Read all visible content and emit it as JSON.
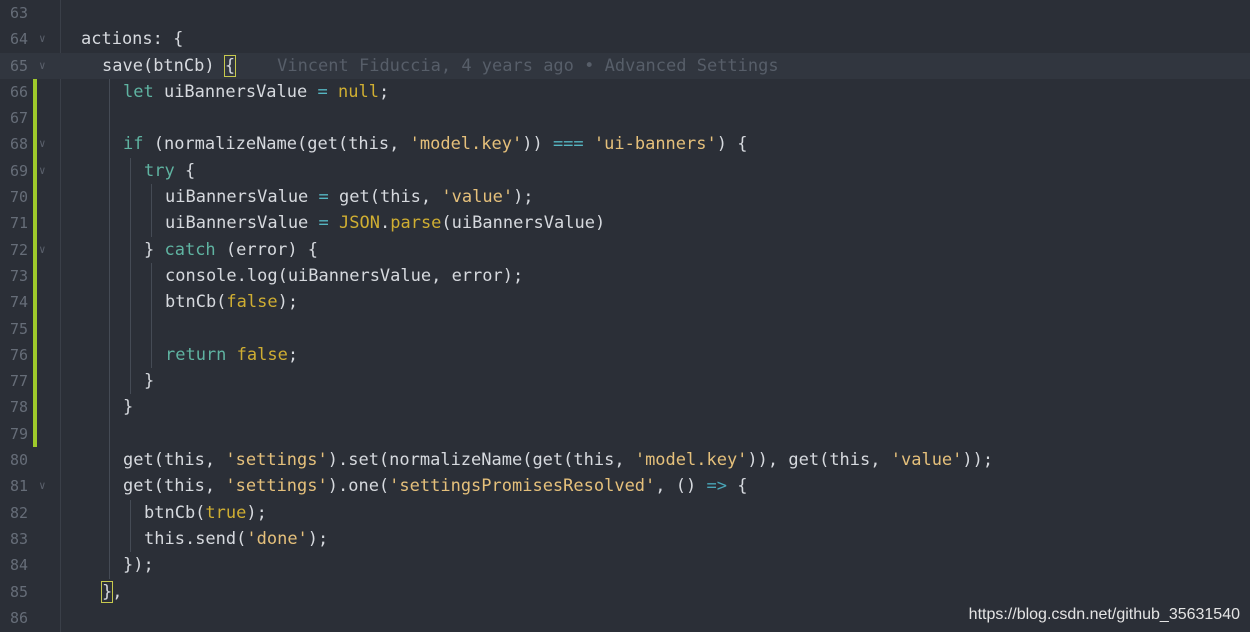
{
  "editor": {
    "colors": {
      "background": "#2b2f37",
      "current_line": "#31363f",
      "line_number": "#666d78",
      "plain": "#d6d9de",
      "keyword": "#5fb3a1",
      "string": "#e5c07b",
      "builtin": "#cfae32",
      "blame": "#575e69",
      "modified_marker": "#9fca2b",
      "operator": "#56b6c2",
      "arrow": "#49a6b8"
    },
    "blame_text": "Vincent Fiduccia, 4 years ago • Advanced Settings",
    "lines": [
      {
        "num": "63",
        "fold": false,
        "modified": false,
        "current": false,
        "indent": 0,
        "tokens": []
      },
      {
        "num": "64",
        "fold": true,
        "modified": false,
        "current": false,
        "indent": 0,
        "tokens": [
          {
            "t": "actions: {",
            "c": "plain"
          }
        ]
      },
      {
        "num": "65",
        "fold": true,
        "modified": false,
        "current": true,
        "indent": 1,
        "blame": true,
        "tokens": [
          {
            "t": "save",
            "c": "plain"
          },
          {
            "t": "(btnCb) ",
            "c": "plain"
          },
          {
            "t": "{",
            "c": "plain",
            "hl": true
          }
        ]
      },
      {
        "num": "66",
        "fold": false,
        "modified": true,
        "current": false,
        "indent": 2,
        "tokens": [
          {
            "t": "let ",
            "c": "keyword"
          },
          {
            "t": "uiBannersValue ",
            "c": "plain"
          },
          {
            "t": "=",
            "c": "operator"
          },
          {
            "t": " ",
            "c": "plain"
          },
          {
            "t": "null",
            "c": "builtin"
          },
          {
            "t": ";",
            "c": "plain"
          }
        ]
      },
      {
        "num": "67",
        "fold": false,
        "modified": true,
        "current": false,
        "indent": 2,
        "tokens": []
      },
      {
        "num": "68",
        "fold": true,
        "modified": true,
        "current": false,
        "indent": 2,
        "tokens": [
          {
            "t": "if ",
            "c": "keyword"
          },
          {
            "t": "(normalizeName(get(",
            "c": "plain"
          },
          {
            "t": "this",
            "c": "plain"
          },
          {
            "t": ", ",
            "c": "plain"
          },
          {
            "t": "'model.key'",
            "c": "string"
          },
          {
            "t": ")) ",
            "c": "plain"
          },
          {
            "t": "===",
            "c": "operator"
          },
          {
            "t": " ",
            "c": "plain"
          },
          {
            "t": "'ui-banners'",
            "c": "string"
          },
          {
            "t": ") {",
            "c": "plain"
          }
        ]
      },
      {
        "num": "69",
        "fold": true,
        "modified": true,
        "current": false,
        "indent": 3,
        "tokens": [
          {
            "t": "try ",
            "c": "keyword"
          },
          {
            "t": "{",
            "c": "plain"
          }
        ]
      },
      {
        "num": "70",
        "fold": false,
        "modified": true,
        "current": false,
        "indent": 4,
        "tokens": [
          {
            "t": "uiBannersValue ",
            "c": "plain"
          },
          {
            "t": "=",
            "c": "operator"
          },
          {
            "t": " get(",
            "c": "plain"
          },
          {
            "t": "this",
            "c": "plain"
          },
          {
            "t": ", ",
            "c": "plain"
          },
          {
            "t": "'value'",
            "c": "string"
          },
          {
            "t": ");",
            "c": "plain"
          }
        ]
      },
      {
        "num": "71",
        "fold": false,
        "modified": true,
        "current": false,
        "indent": 4,
        "tokens": [
          {
            "t": "uiBannersValue ",
            "c": "plain"
          },
          {
            "t": "=",
            "c": "operator"
          },
          {
            "t": " ",
            "c": "plain"
          },
          {
            "t": "JSON",
            "c": "builtin"
          },
          {
            "t": ".",
            "c": "plain"
          },
          {
            "t": "parse",
            "c": "builtin"
          },
          {
            "t": "(uiBannersValue)",
            "c": "plain"
          }
        ]
      },
      {
        "num": "72",
        "fold": true,
        "modified": true,
        "current": false,
        "indent": 3,
        "tokens": [
          {
            "t": "} ",
            "c": "plain"
          },
          {
            "t": "catch ",
            "c": "keyword"
          },
          {
            "t": "(error) {",
            "c": "plain"
          }
        ]
      },
      {
        "num": "73",
        "fold": false,
        "modified": true,
        "current": false,
        "indent": 4,
        "tokens": [
          {
            "t": "console.log(uiBannersValue, error);",
            "c": "plain"
          }
        ]
      },
      {
        "num": "74",
        "fold": false,
        "modified": true,
        "current": false,
        "indent": 4,
        "tokens": [
          {
            "t": "btnCb(",
            "c": "plain"
          },
          {
            "t": "false",
            "c": "builtin"
          },
          {
            "t": ");",
            "c": "plain"
          }
        ]
      },
      {
        "num": "75",
        "fold": false,
        "modified": true,
        "current": false,
        "indent": 4,
        "tokens": []
      },
      {
        "num": "76",
        "fold": false,
        "modified": true,
        "current": false,
        "indent": 4,
        "tokens": [
          {
            "t": "return ",
            "c": "keyword"
          },
          {
            "t": "false",
            "c": "builtin"
          },
          {
            "t": ";",
            "c": "plain"
          }
        ]
      },
      {
        "num": "77",
        "fold": false,
        "modified": true,
        "current": false,
        "indent": 3,
        "tokens": [
          {
            "t": "}",
            "c": "plain"
          }
        ]
      },
      {
        "num": "78",
        "fold": false,
        "modified": true,
        "current": false,
        "indent": 2,
        "tokens": [
          {
            "t": "}",
            "c": "plain"
          }
        ]
      },
      {
        "num": "79",
        "fold": false,
        "modified": true,
        "current": false,
        "indent": 2,
        "tokens": []
      },
      {
        "num": "80",
        "fold": false,
        "modified": false,
        "current": false,
        "indent": 2,
        "tokens": [
          {
            "t": "get(",
            "c": "plain"
          },
          {
            "t": "this",
            "c": "plain"
          },
          {
            "t": ", ",
            "c": "plain"
          },
          {
            "t": "'settings'",
            "c": "string"
          },
          {
            "t": ").set(normalizeName(get(",
            "c": "plain"
          },
          {
            "t": "this",
            "c": "plain"
          },
          {
            "t": ", ",
            "c": "plain"
          },
          {
            "t": "'model.key'",
            "c": "string"
          },
          {
            "t": ")), get(",
            "c": "plain"
          },
          {
            "t": "this",
            "c": "plain"
          },
          {
            "t": ", ",
            "c": "plain"
          },
          {
            "t": "'value'",
            "c": "string"
          },
          {
            "t": "));",
            "c": "plain"
          }
        ]
      },
      {
        "num": "81",
        "fold": true,
        "modified": false,
        "current": false,
        "indent": 2,
        "tokens": [
          {
            "t": "get(",
            "c": "plain"
          },
          {
            "t": "this",
            "c": "plain"
          },
          {
            "t": ", ",
            "c": "plain"
          },
          {
            "t": "'settings'",
            "c": "string"
          },
          {
            "t": ").one(",
            "c": "plain"
          },
          {
            "t": "'settingsPromisesResolved'",
            "c": "string"
          },
          {
            "t": ", () ",
            "c": "plain"
          },
          {
            "t": "=>",
            "c": "arrow"
          },
          {
            "t": " {",
            "c": "plain"
          }
        ]
      },
      {
        "num": "82",
        "fold": false,
        "modified": false,
        "current": false,
        "indent": 3,
        "tokens": [
          {
            "t": "btnCb(",
            "c": "plain"
          },
          {
            "t": "true",
            "c": "builtin"
          },
          {
            "t": ");",
            "c": "plain"
          }
        ]
      },
      {
        "num": "83",
        "fold": false,
        "modified": false,
        "current": false,
        "indent": 3,
        "tokens": [
          {
            "t": "this",
            "c": "plain"
          },
          {
            "t": ".send(",
            "c": "plain"
          },
          {
            "t": "'done'",
            "c": "string"
          },
          {
            "t": ");",
            "c": "plain"
          }
        ]
      },
      {
        "num": "84",
        "fold": false,
        "modified": false,
        "current": false,
        "indent": 2,
        "tokens": [
          {
            "t": "});",
            "c": "plain"
          }
        ]
      },
      {
        "num": "85",
        "fold": false,
        "modified": false,
        "current": false,
        "indent": 1,
        "tokens": [
          {
            "t": "}",
            "c": "plain",
            "hl": true
          },
          {
            "t": ",",
            "c": "plain"
          }
        ]
      },
      {
        "num": "86",
        "fold": false,
        "modified": false,
        "current": false,
        "indent": 1,
        "tokens": []
      }
    ]
  },
  "watermark": "https://blog.csdn.net/github_35631540"
}
